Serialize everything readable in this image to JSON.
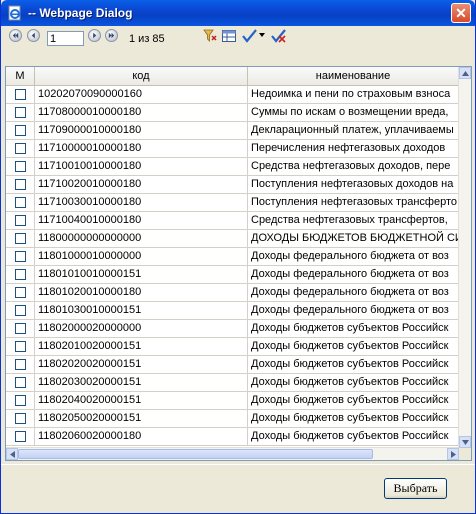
{
  "window": {
    "title": "-- Webpage Dialog"
  },
  "pager": {
    "page_value": "1",
    "page_info": "1 из 85"
  },
  "grid": {
    "columns": [
      "M",
      "код",
      "наименование"
    ],
    "rows": [
      {
        "code": "10202070090000160",
        "name": "Недоимка и пени по страховым взноса"
      },
      {
        "code": "11708000010000180",
        "name": "Суммы по искам о возмещении вреда,"
      },
      {
        "code": "11709000010000180",
        "name": "Декларационный платеж, уплачиваемы"
      },
      {
        "code": "11710000010000180",
        "name": "Перечисления нефтегазовых доходов"
      },
      {
        "code": "11710010010000180",
        "name": "Средства нефтегазовых доходов, пере"
      },
      {
        "code": "11710020010000180",
        "name": "Поступления нефтегазовых доходов на"
      },
      {
        "code": "11710030010000180",
        "name": "Поступления нефтегазовых трансферто"
      },
      {
        "code": "11710040010000180",
        "name": "Средства нефтегазовых трансфертов,"
      },
      {
        "code": "11800000000000000",
        "name": "ДОХОДЫ БЮДЖЕТОВ БЮДЖЕТНОЙ СИС"
      },
      {
        "code": "11801000010000000",
        "name": "Доходы федерального бюджета от воз"
      },
      {
        "code": "11801010010000151",
        "name": "Доходы федерального бюджета от воз"
      },
      {
        "code": "11801020010000180",
        "name": "Доходы федерального бюджета от воз"
      },
      {
        "code": "11801030010000151",
        "name": "Доходы федерального бюджета от воз"
      },
      {
        "code": "11802000020000000",
        "name": "Доходы бюджетов субъектов Российск"
      },
      {
        "code": "11802010020000151",
        "name": "Доходы бюджетов субъектов Российск"
      },
      {
        "code": "11802020020000151",
        "name": "Доходы бюджетов субъектов Российск"
      },
      {
        "code": "11802030020000151",
        "name": "Доходы бюджетов субъектов Российск"
      },
      {
        "code": "11802040020000151",
        "name": "Доходы бюджетов субъектов Российск"
      },
      {
        "code": "11802050020000151",
        "name": "Доходы бюджетов субъектов Российск"
      },
      {
        "code": "11802060020000180",
        "name": "Доходы бюджетов субъектов Российск"
      }
    ]
  },
  "footer": {
    "select_label": "Выбрать"
  },
  "icons": {
    "window": "ie-page-icon",
    "close": "close-icon",
    "first": "first-page-icon",
    "prev": "prev-page-icon",
    "next": "next-page-icon",
    "last": "last-page-icon",
    "filter": "filter-icon",
    "columns": "columns-icon",
    "check_all": "checkmark-icon",
    "uncheck_all": "uncheck-icon"
  }
}
